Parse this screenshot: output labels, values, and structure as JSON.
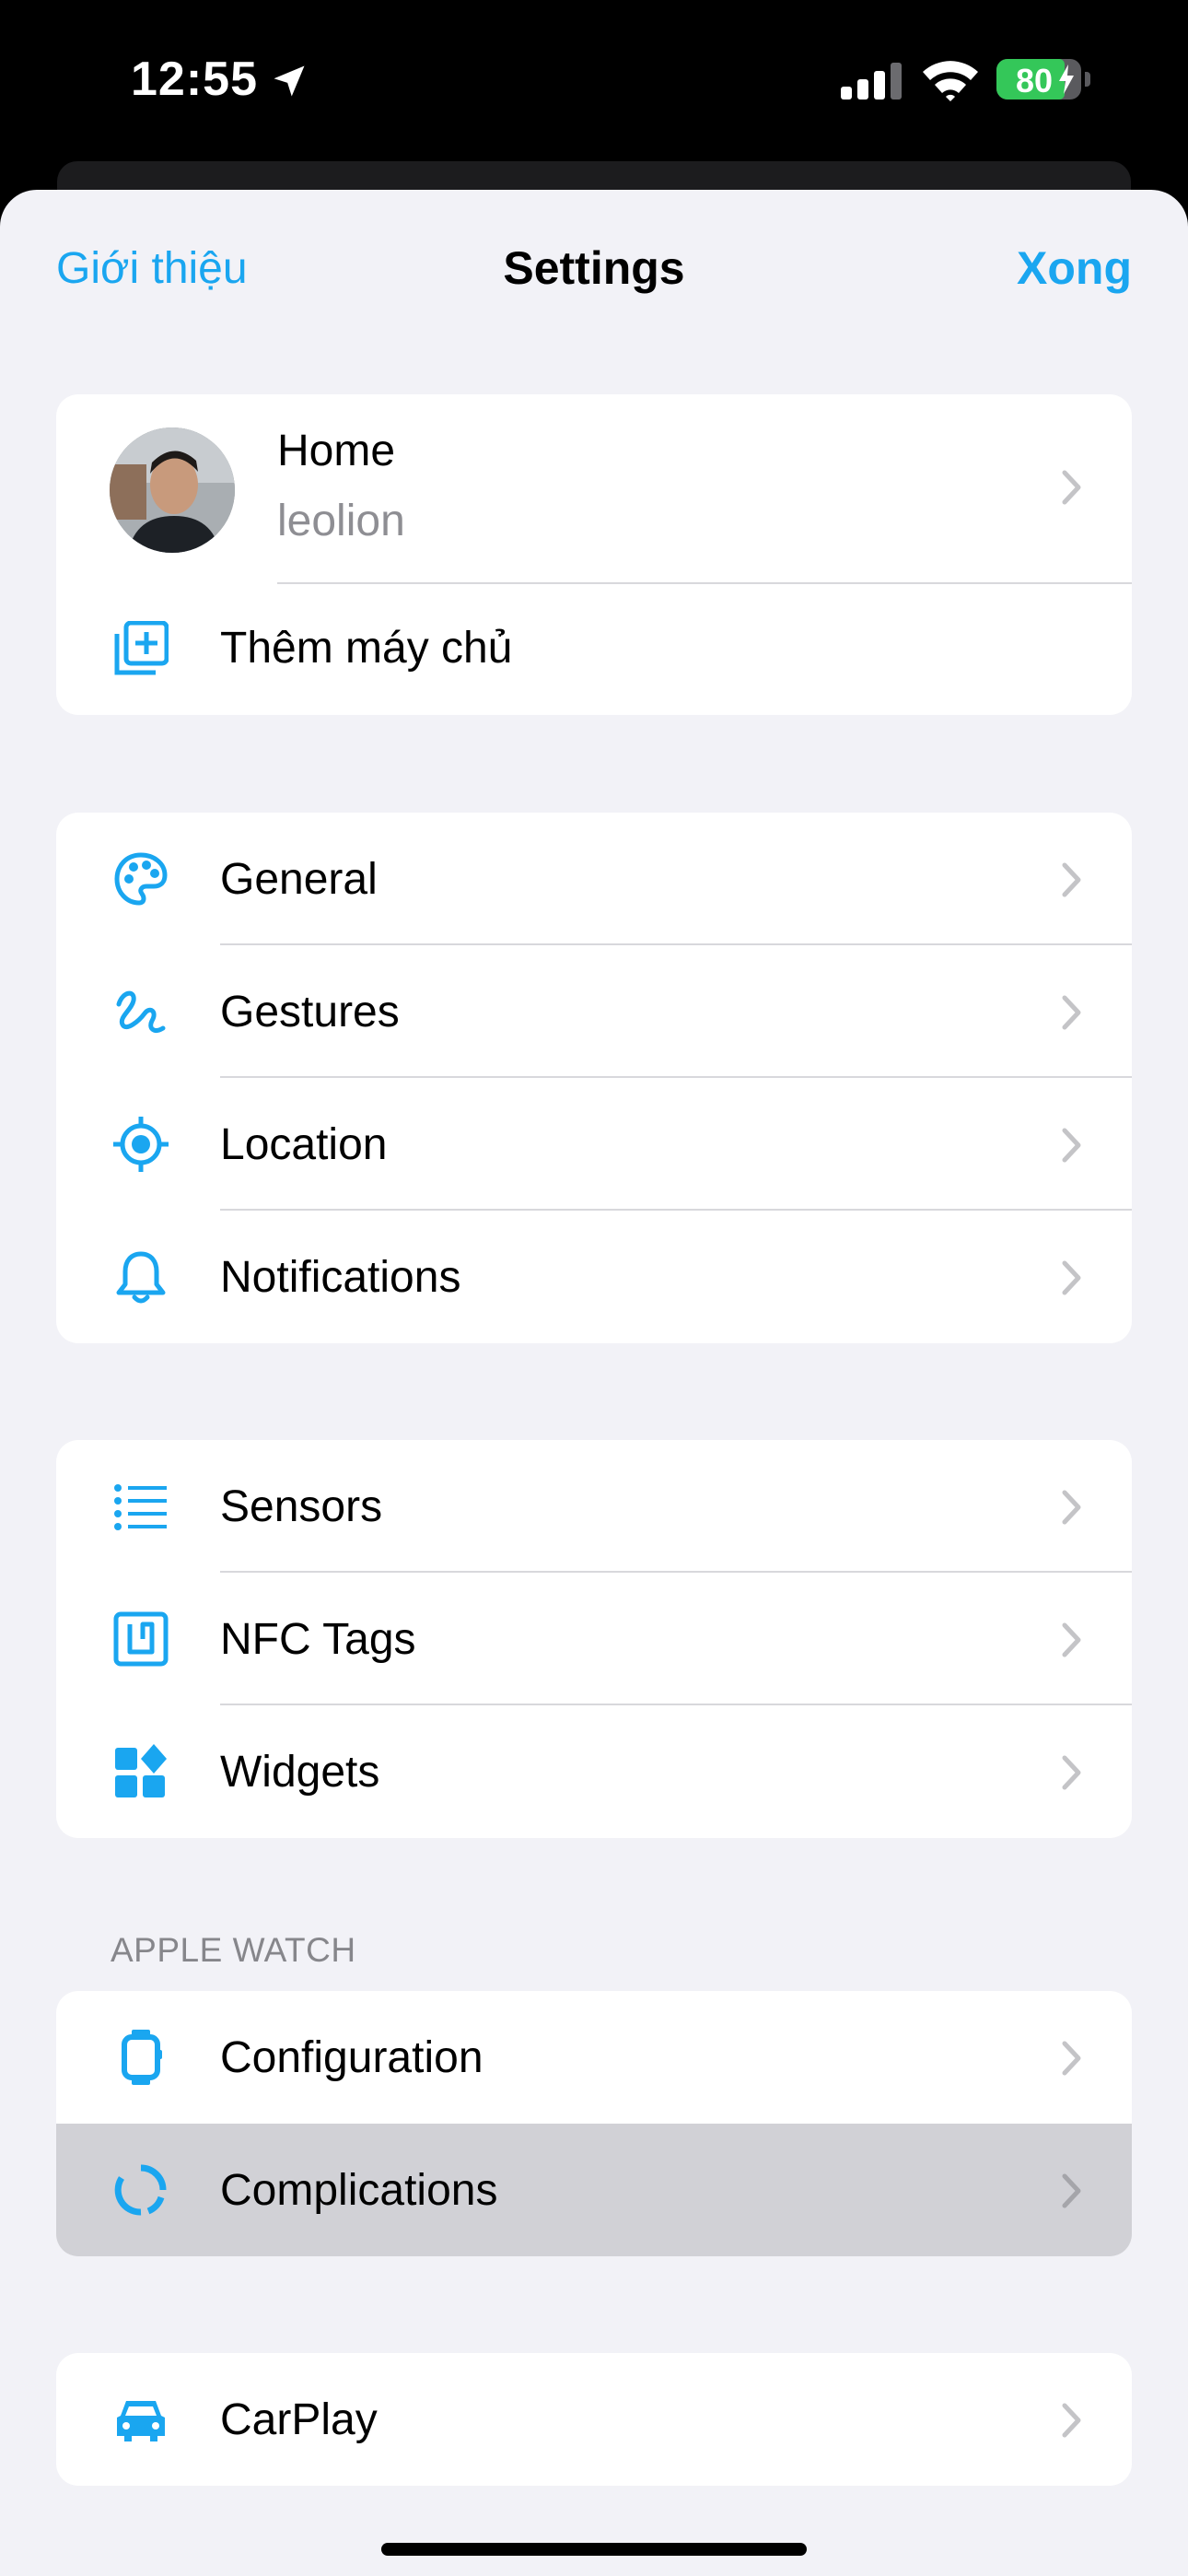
{
  "status_bar": {
    "time": "12:55",
    "battery": "80"
  },
  "nav": {
    "left": "Giới thiệu",
    "title": "Settings",
    "right": "Xong"
  },
  "profile": {
    "name": "Home",
    "username": "leolion",
    "add_server": "Thêm máy chủ"
  },
  "group1": [
    {
      "label": "General",
      "icon": "palette-icon"
    },
    {
      "label": "Gestures",
      "icon": "gesture-icon"
    },
    {
      "label": "Location",
      "icon": "location-icon"
    },
    {
      "label": "Notifications",
      "icon": "bell-icon"
    }
  ],
  "group2": [
    {
      "label": "Sensors",
      "icon": "list-icon"
    },
    {
      "label": "NFC Tags",
      "icon": "nfc-icon"
    },
    {
      "label": "Widgets",
      "icon": "widgets-icon"
    }
  ],
  "apple_watch": {
    "header": "APPLE WATCH",
    "items": [
      {
        "label": "Configuration",
        "icon": "watch-icon"
      },
      {
        "label": "Complications",
        "icon": "complications-icon"
      }
    ]
  },
  "carplay": {
    "label": "CarPlay",
    "icon": "car-icon"
  },
  "colors": {
    "accent": "#1aa6f0",
    "background": "#f2f2f7",
    "highlight": "#d1d1d6",
    "battery": "#34c759"
  }
}
